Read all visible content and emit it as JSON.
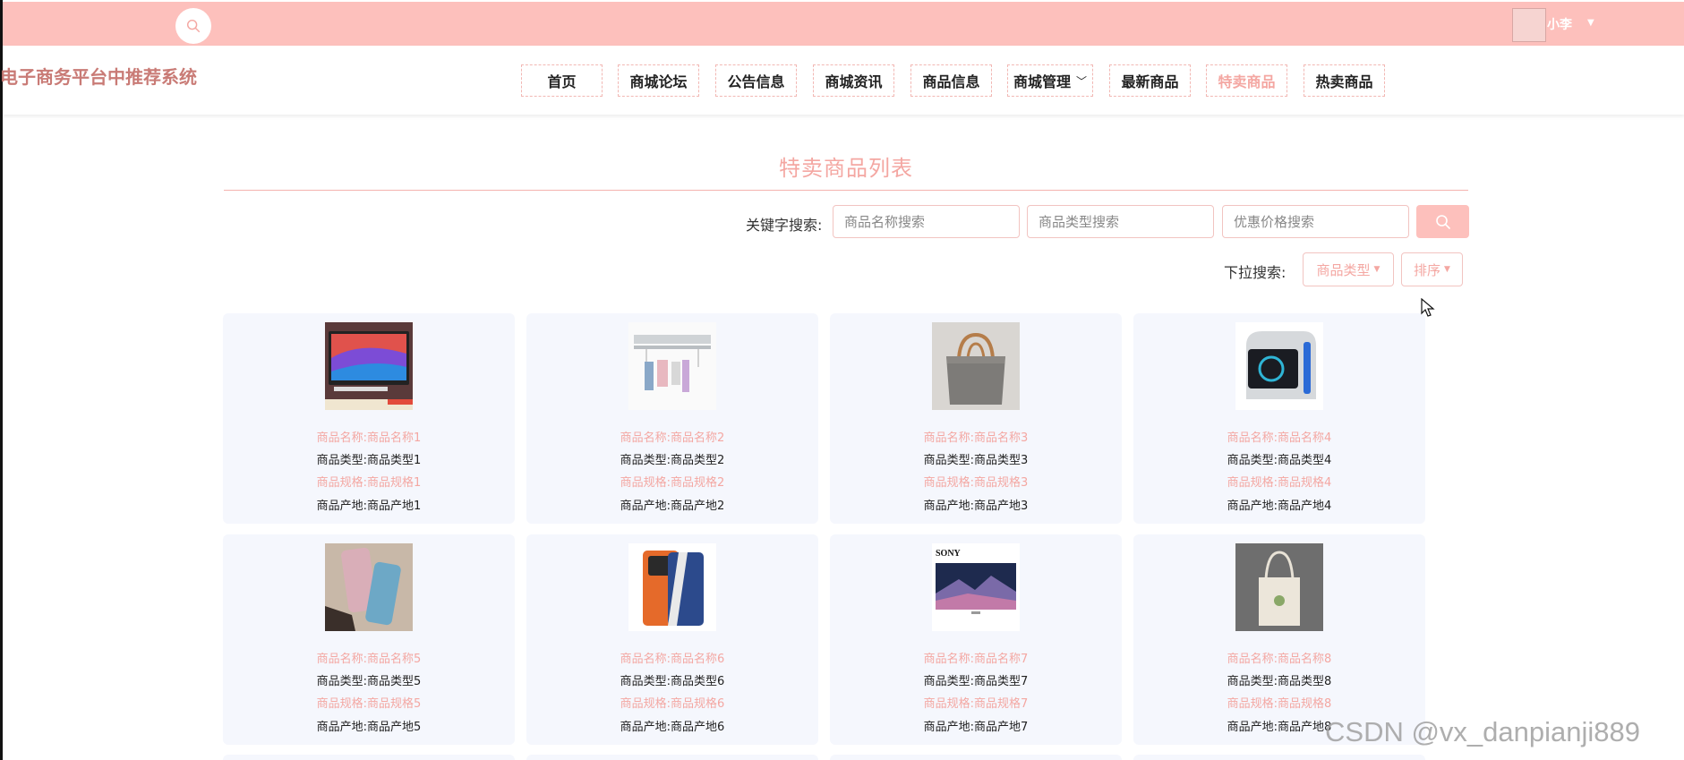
{
  "header": {
    "user_name": "小李",
    "site_title": "电子商务平台中推荐系统"
  },
  "nav": [
    {
      "label": "首页"
    },
    {
      "label": "商城论坛"
    },
    {
      "label": "公告信息"
    },
    {
      "label": "商城资讯"
    },
    {
      "label": "商品信息"
    },
    {
      "label": "商城管理",
      "has_dropdown": true
    },
    {
      "label": "最新商品"
    },
    {
      "label": "特卖商品",
      "active": true
    },
    {
      "label": "热卖商品"
    }
  ],
  "page": {
    "title": "特卖商品列表"
  },
  "search": {
    "keyword_label": "关键字搜索:",
    "name_placeholder": "商品名称搜索",
    "type_placeholder": "商品类型搜索",
    "price_placeholder": "优惠价格搜索",
    "dropdown_label": "下拉搜索:",
    "type_dropdown": "商品类型",
    "sort_dropdown": "排序"
  },
  "products": [
    {
      "name": "商品名称:商品名称1",
      "type": "商品类型:商品类型1",
      "spec": "商品规格:商品规格1",
      "origin": "商品产地:商品产地1",
      "image": "imac-desktop"
    },
    {
      "name": "商品名称:商品名称2",
      "type": "商品类型:商品类型2",
      "spec": "商品规格:商品规格2",
      "origin": "商品产地:商品产地2",
      "image": "clothes-drying-rack"
    },
    {
      "name": "商品名称:商品名称3",
      "type": "商品类型:商品类型3",
      "spec": "商品规格:商品规格3",
      "origin": "商品产地:商品产地3",
      "image": "felt-tote-bag"
    },
    {
      "name": "商品名称:商品名称4",
      "type": "商品类型:商品类型4",
      "spec": "商品规格:商品规格4",
      "origin": "商品产地:商品产地4",
      "image": "gaming-pc"
    },
    {
      "name": "商品名称:商品名称5",
      "type": "商品类型:商品类型5",
      "spec": "商品规格:商品规格5",
      "origin": "商品产地:商品产地5",
      "image": "phone-cases"
    },
    {
      "name": "商品名称:商品名称6",
      "type": "商品类型:商品类型6",
      "spec": "商品规格:商品规格6",
      "origin": "商品产地:商品产地6",
      "image": "smartphone"
    },
    {
      "name": "商品名称:商品名称7",
      "type": "商品类型:商品类型7",
      "spec": "商品规格:商品规格7",
      "origin": "商品产地:商品产地7",
      "image": "sony-tv",
      "brand_text": "SONY"
    },
    {
      "name": "商品名称:商品名称8",
      "type": "商品类型:商品类型8",
      "spec": "商品规格:商品规格8",
      "origin": "商品产地:商品产地8",
      "image": "canvas-bag"
    }
  ],
  "watermark": "CSDN @vx_danpianji889",
  "colors": {
    "topbar": "#fdc0bc",
    "accent_pink": "#f4a7a2",
    "card_bg": "#f5f7fd",
    "logo": "#c97b76"
  }
}
